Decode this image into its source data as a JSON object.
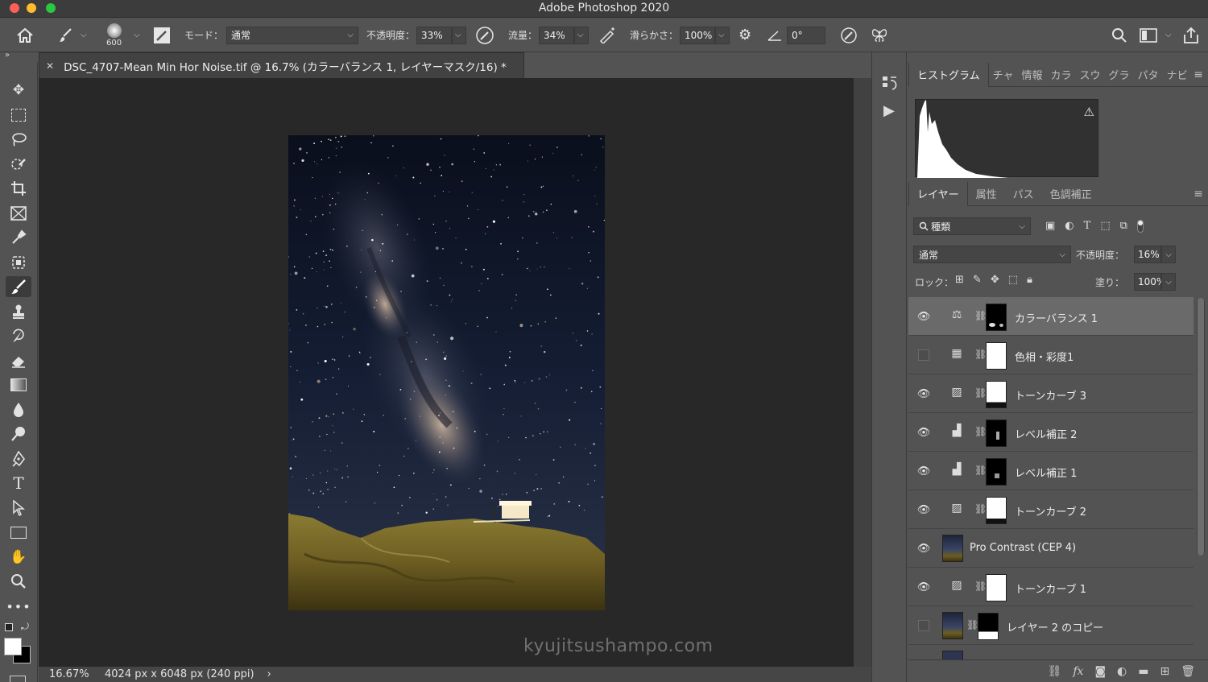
{
  "app": {
    "title": "Adobe Photoshop 2020"
  },
  "options": {
    "brush_size": "600",
    "mode_label": "モード：",
    "mode_value": "通常",
    "opacity_label": "不透明度：",
    "opacity_value": "33%",
    "flow_label": "流量：",
    "flow_value": "34%",
    "smoothing_label": "滑らかさ：",
    "smoothing_value": "100%",
    "angle_value": "0°"
  },
  "document": {
    "tab_title": "DSC_4707-Mean Min Hor Noise.tif @ 16.7% (カラーバランス 1, レイヤーマスク/16) *",
    "zoom": "16.67%",
    "size_info": "4024 px x 6048 px (240 ppi)",
    "watermark": "kyujitsushampo.com"
  },
  "top_panel": {
    "tabs": [
      "ヒストグラム",
      "チャ",
      "情報",
      "カラ",
      "スウ",
      "グラ",
      "パタ",
      "ナビ"
    ]
  },
  "layers_panel": {
    "tabs": [
      "レイヤー",
      "属性",
      "パス",
      "色調補正"
    ],
    "filter_label": "種類",
    "blend_mode": "通常",
    "opacity_label": "不透明度：",
    "opacity_value": "16%",
    "lock_label": "ロック：",
    "fill_label": "塗り：",
    "fill_value": "100%",
    "layers": [
      {
        "name": "カラーバランス 1",
        "visible": true,
        "selected": true,
        "icon": "balance-icon",
        "mask": "black-with-white"
      },
      {
        "name": "色相・彩度1",
        "visible": false,
        "selected": false,
        "icon": "hue-sat-icon",
        "mask": "white"
      },
      {
        "name": "トーンカーブ 3",
        "visible": true,
        "selected": false,
        "icon": "curves-icon",
        "mask": "white-dark-bottom"
      },
      {
        "name": "レベル補正 2",
        "visible": true,
        "selected": false,
        "icon": "levels-icon",
        "mask": "black-speck"
      },
      {
        "name": "レベル補正 1",
        "visible": true,
        "selected": false,
        "icon": "levels-icon",
        "mask": "black-speck"
      },
      {
        "name": "トーンカーブ 2",
        "visible": true,
        "selected": false,
        "icon": "curves-icon",
        "mask": "white-dark-bottom"
      },
      {
        "name": "Pro Contrast (CEP 4)",
        "visible": true,
        "selected": false,
        "icon": "photo-thumb",
        "mask": "none"
      },
      {
        "name": "トーンカーブ 1",
        "visible": true,
        "selected": false,
        "icon": "curves-icon",
        "mask": "white"
      },
      {
        "name": "レイヤー 2 のコピー",
        "visible": false,
        "selected": false,
        "icon": "photo-thumb",
        "mask": "black-white-bottom"
      }
    ]
  }
}
